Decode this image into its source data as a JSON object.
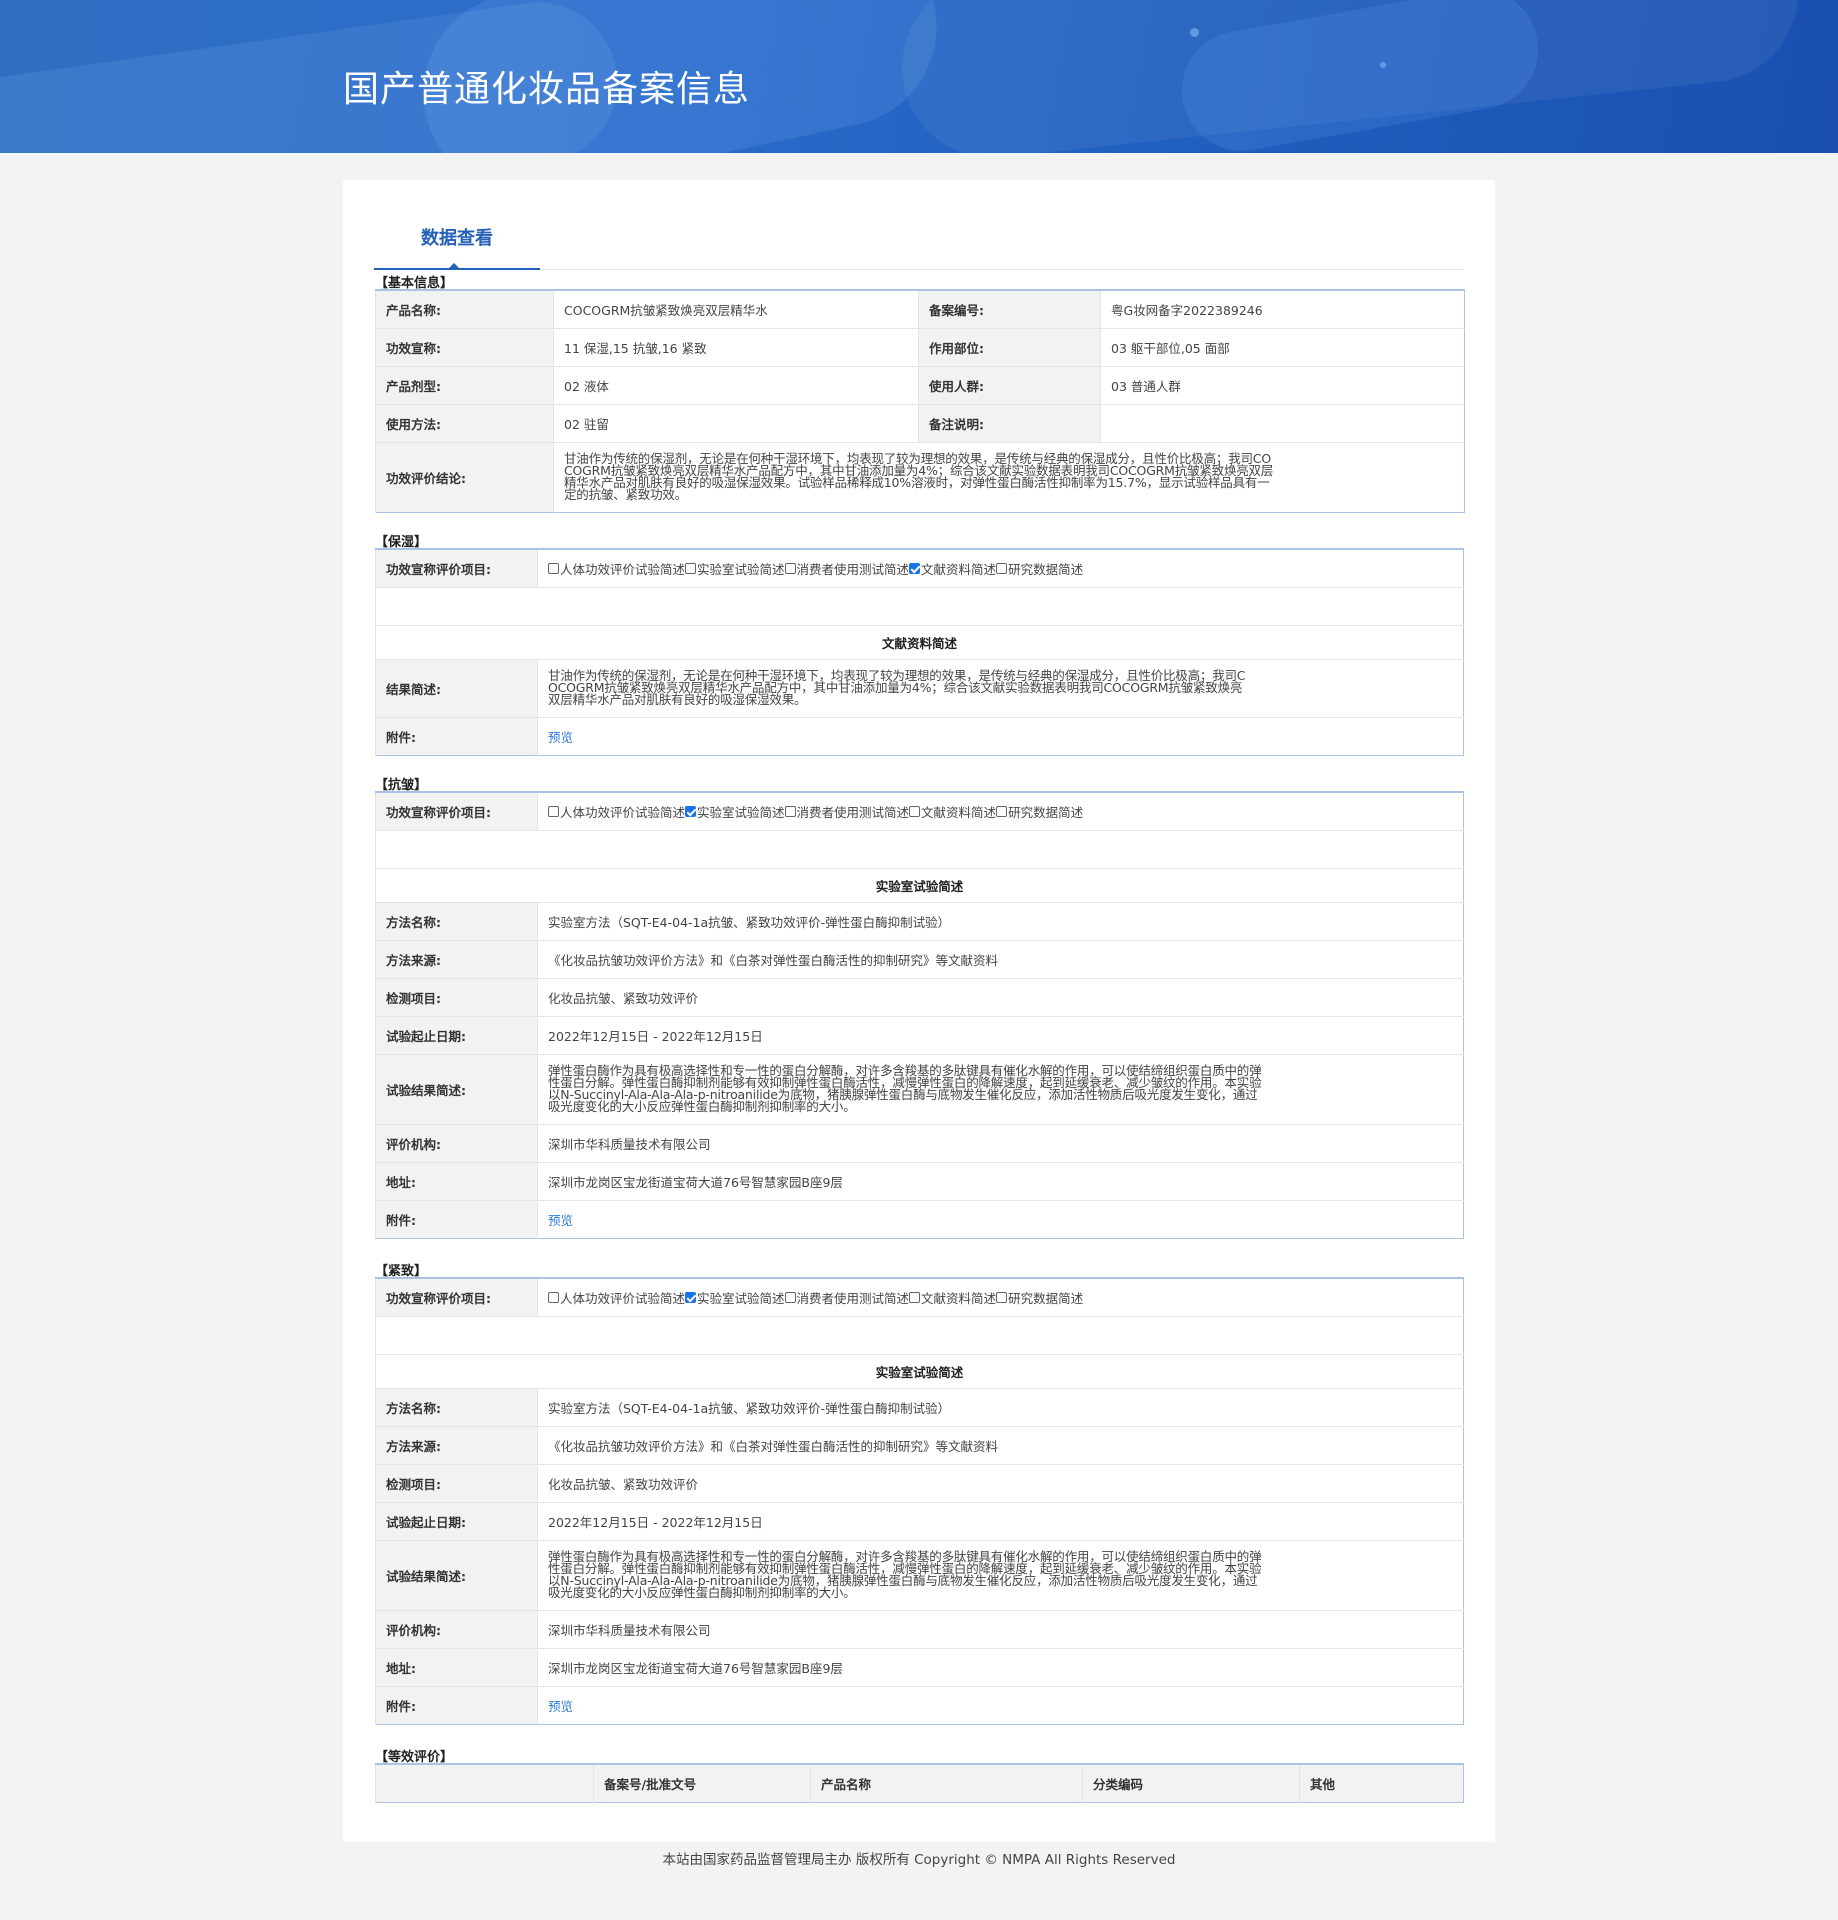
{
  "header": {
    "title": "国产普通化妆品备案信息"
  },
  "tab": {
    "label": "数据查看"
  },
  "basic": {
    "section": "【基本信息】",
    "product_name_label": "产品名称:",
    "product_name": "COCOGRM抗皱紧致焕亮双层精华水",
    "record_no_label": "备案编号:",
    "record_no": "粤G妆网备字2022389246",
    "claim_label": "功效宣称:",
    "claim": "11 保湿,15 抗皱,16 紧致",
    "site_label": "作用部位:",
    "site": "03 躯干部位,05 面部",
    "form_label": "产品剂型:",
    "form": "02 液体",
    "crowd_label": "使用人群:",
    "crowd": "03 普通人群",
    "usage_label": "使用方法:",
    "usage": "02 驻留",
    "note_label": "备注说明:",
    "note": "",
    "conclusion_label": "功效评价结论:",
    "conclusion": "甘油作为传统的保湿剂，无论是在何种干湿环境下，均表现了较为理想的效果，是传统与经典的保湿成分，且性价比极高；我司COCOGRM抗皱紧致焕亮双层精华水产品配方中，其中甘油添加量为4%；综合该文献实验数据表明我司COCOGRM抗皱紧致焕亮双层精华水产品对肌肤有良好的吸湿保湿效果。试验样品稀释成10%溶液时，对弹性蛋白酶活性抑制率为15.7%，显示试验样品具有一定的抗皱、紧致功效。"
  },
  "checkbox_labels": [
    "人体功效评价试验简述",
    "实验室试验简述",
    "消费者使用测试简述",
    "文献资料简述",
    "研究数据简述"
  ],
  "moisture": {
    "section": "【保湿】",
    "items_label": "功效宣称评价项目:",
    "checked": [
      false,
      false,
      false,
      true,
      false
    ],
    "sub_title": "文献资料简述",
    "result_label": "结果简述:",
    "result": "甘油作为传统的保湿剂，无论是在何种干湿环境下，均表现了较为理想的效果，是传统与经典的保湿成分，且性价比极高；我司COCOGRM抗皱紧致焕亮双层精华水产品配方中，其中甘油添加量为4%；综合该文献实验数据表明我司COCOGRM抗皱紧致焕亮双层精华水产品对肌肤有良好的吸湿保湿效果。",
    "attach_label": "附件:",
    "attach_link": "预览"
  },
  "antiwrinkle": {
    "section": "【抗皱】",
    "items_label": "功效宣称评价项目:",
    "checked": [
      false,
      true,
      false,
      false,
      false
    ],
    "sub_title": "实验室试验简述",
    "method_name_label": "方法名称:",
    "method_name": "实验室方法（SQT-E4-04-1a抗皱、紧致功效评价-弹性蛋白酶抑制试验）",
    "method_src_label": "方法来源:",
    "method_src": "《化妆品抗皱功效评价方法》和《白茶对弹性蛋白酶活性的抑制研究》等文献资料",
    "test_item_label": "检测项目:",
    "test_item": "化妆品抗皱、紧致功效评价",
    "date_label": "试验起止日期:",
    "date": "2022年12月15日 - 2022年12月15日",
    "result_label": "试验结果简述:",
    "result": "弹性蛋白酶作为具有极高选择性和专一性的蛋白分解酶，对许多含羧基的多肽键具有催化水解的作用，可以使结缔组织蛋白质中的弹性蛋白分解。弹性蛋白酶抑制剂能够有效抑制弹性蛋白酶活性，减慢弹性蛋白的降解速度，起到延缓衰老、减少皱纹的作用。本实验以N-Succinyl-Ala-Ala-Ala-p-nitroanilide为底物，猪胰腺弹性蛋白酶与底物发生催化反应，添加活性物质后吸光度发生变化，通过吸光度变化的大小反应弹性蛋白酶抑制剂抑制率的大小。",
    "org_label": "评价机构:",
    "org": "深圳市华科质量技术有限公司",
    "addr_label": "地址:",
    "addr": "深圳市龙岗区宝龙街道宝荷大道76号智慧家园B座9层",
    "attach_label": "附件:",
    "attach_link": "预览"
  },
  "firming": {
    "section": "【紧致】",
    "items_label": "功效宣称评价项目:",
    "checked": [
      false,
      true,
      false,
      false,
      false
    ],
    "sub_title": "实验室试验简述",
    "method_name_label": "方法名称:",
    "method_name": "实验室方法（SQT-E4-04-1a抗皱、紧致功效评价-弹性蛋白酶抑制试验）",
    "method_src_label": "方法来源:",
    "method_src": "《化妆品抗皱功效评价方法》和《白茶对弹性蛋白酶活性的抑制研究》等文献资料",
    "test_item_label": "检测项目:",
    "test_item": "化妆品抗皱、紧致功效评价",
    "date_label": "试验起止日期:",
    "date": "2022年12月15日 - 2022年12月15日",
    "result_label": "试验结果简述:",
    "result": "弹性蛋白酶作为具有极高选择性和专一性的蛋白分解酶，对许多含羧基的多肽键具有催化水解的作用，可以使结缔组织蛋白质中的弹性蛋白分解。弹性蛋白酶抑制剂能够有效抑制弹性蛋白酶活性，减慢弹性蛋白的降解速度，起到延缓衰老、减少皱纹的作用。本实验以N-Succinyl-Ala-Ala-Ala-p-nitroanilide为底物，猪胰腺弹性蛋白酶与底物发生催化反应，添加活性物质后吸光度发生变化，通过吸光度变化的大小反应弹性蛋白酶抑制剂抑制率的大小。",
    "org_label": "评价机构:",
    "org": "深圳市华科质量技术有限公司",
    "addr_label": "地址:",
    "addr": "深圳市龙岗区宝龙街道宝荷大道76号智慧家园B座9层",
    "attach_label": "附件:",
    "attach_link": "预览"
  },
  "equivalent": {
    "section": "【等效评价】",
    "columns": [
      "",
      "备案号/批准文号",
      "产品名称",
      "分类编码",
      "其他"
    ]
  },
  "footer": {
    "text": "本站由国家药品监督管理局主办 版权所有 Copyright © NMPA All Rights Reserved"
  }
}
